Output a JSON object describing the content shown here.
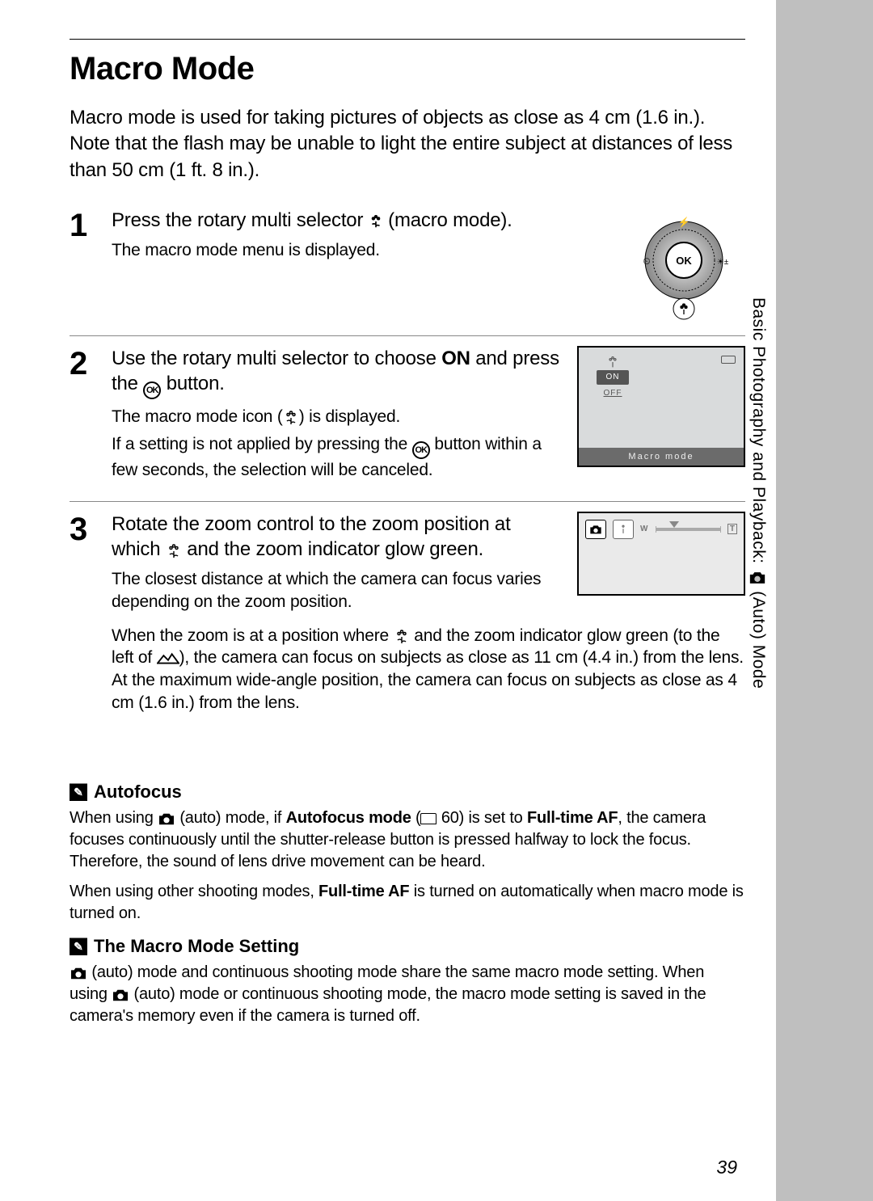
{
  "sidebar": {
    "text_before": "Basic Photography and Playback: ",
    "text_after": " (Auto) Mode"
  },
  "title": "Macro Mode",
  "intro": "Macro mode is used for taking pictures of objects as close as 4 cm (1.6 in.). Note that the flash may be unable to light the entire subject at distances of less than 50 cm (1 ft. 8 in.).",
  "steps": [
    {
      "num": "1",
      "title_a": "Press the rotary multi selector ",
      "title_b": " (macro mode).",
      "desc": "The macro mode menu is displayed."
    },
    {
      "num": "2",
      "title_a": "Use the rotary multi selector to choose ",
      "title_bold": "ON",
      "title_b": " and press the ",
      "title_c": " button.",
      "desc_a": "The macro mode icon (",
      "desc_b": ") is displayed.",
      "desc2_a": "If a setting is not applied by pressing the ",
      "desc2_b": " button within a few seconds, the selection will be canceled.",
      "lcd": {
        "on": "ON",
        "off": "OFF",
        "foot": "Macro mode"
      }
    },
    {
      "num": "3",
      "title_a": "Rotate the zoom control to the zoom position at which ",
      "title_b": " and the zoom indicator glow green.",
      "desc": "The closest distance at which the camera can focus varies depending on the zoom position.",
      "desc2_a": "When the zoom is at a position where ",
      "desc2_b": " and the zoom indicator glow green (to the left of ",
      "desc2_c": "), the camera can focus on subjects as close as 11 cm (4.4 in.) from the lens. At the maximum wide-angle position, the camera can focus on subjects as close as 4 cm (1.6 in.) from the lens."
    }
  ],
  "notes": {
    "af": {
      "head": "Autofocus",
      "p1_a": "When using ",
      "p1_b": " (auto) mode, if ",
      "p1_bold1": "Autofocus mode",
      "p1_c": " (",
      "p1_page": " 60) is set to ",
      "p1_bold2": "Full-time AF",
      "p1_d": ", the camera focuses continuously until the shutter-release button is pressed halfway to lock the focus. Therefore, the sound of lens drive movement can be heard.",
      "p2_a": "When using other shooting modes, ",
      "p2_bold": "Full-time AF",
      "p2_b": " is turned on automatically when macro mode is turned on."
    },
    "mm": {
      "head": "The Macro Mode Setting",
      "p_a1": "",
      "p_a": " (auto) mode and continuous shooting mode share the same macro mode setting. When using ",
      "p_b": " (auto) mode or continuous shooting mode, the macro mode setting is saved in the camera's memory even if the camera is turned off."
    }
  },
  "page": "39",
  "ok": "OK",
  "zoom": {
    "w": "W",
    "t": "T"
  }
}
